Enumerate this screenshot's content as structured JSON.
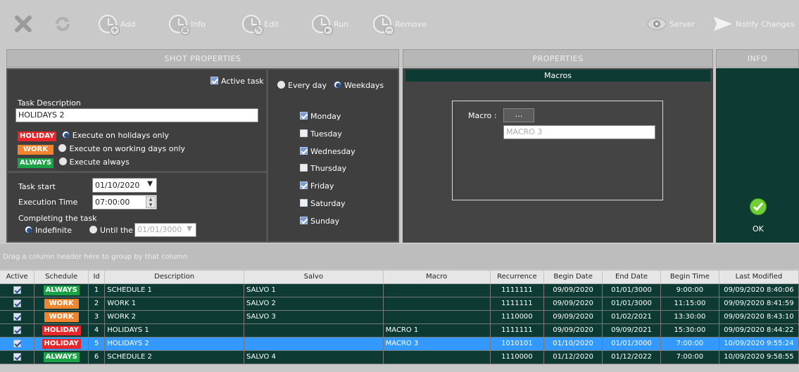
{
  "toolbar": {
    "add": "Add",
    "info": "Info",
    "edit": "Edit",
    "run": "Run",
    "remove": "Remove",
    "server": "Server",
    "notify": "Notify Changes"
  },
  "panels": {
    "shot_properties": "SHOT  PROPERTIES",
    "properties": "PROPERTIES",
    "info": "INFO"
  },
  "shot": {
    "active_task": "Active task",
    "task_description_label": "Task Description",
    "task_description_value": "HOLIDAYS 2",
    "holiday_badge": "HOLIDAY",
    "holiday_text": "Execute on holidays only",
    "work_badge": "WORK",
    "work_text": "Execute on working days only",
    "always_badge": "ALWAYS",
    "always_text": "Execute always",
    "task_start_label": "Task start",
    "task_start_value": "01/10/2020",
    "execution_time_label": "Execution Time",
    "execution_time_value": "07:00:00",
    "completing_label": "Completing the task",
    "indefinite": "Indefinite",
    "until_the": "Until the",
    "until_value": "01/01/3000"
  },
  "days": {
    "every_day": "Every day",
    "weekdays": "Weekdays",
    "items": [
      {
        "label": "Monday",
        "checked": true
      },
      {
        "label": "Tuesday",
        "checked": false
      },
      {
        "label": "Wednesday",
        "checked": true
      },
      {
        "label": "Thursday",
        "checked": false
      },
      {
        "label": "Friday",
        "checked": true
      },
      {
        "label": "Saturday",
        "checked": false
      },
      {
        "label": "Sunday",
        "checked": true
      }
    ]
  },
  "macros": {
    "title": "Macros",
    "macro_label": "Macro :",
    "browse": "...",
    "value": "MACRO 3"
  },
  "info": {
    "ok": "OK"
  },
  "grid": {
    "group_hint": "Drag a column header here to group by that column",
    "columns": [
      "Active",
      "Schedule",
      "Id",
      "Description",
      "Salvo",
      "Macro",
      "Recurrence",
      "Begin Date",
      "End Date",
      "Begin Time",
      "Last Modified"
    ],
    "rows": [
      {
        "schedule": "ALWAYS",
        "id": "1",
        "description": "SCHEDULE 1",
        "salvo": "SALVO 1",
        "macro": "",
        "recurrence": "1111111",
        "begin_date": "09/09/2020",
        "end_date": "01/01/3000",
        "begin_time": "9:00:00",
        "last_modified": "09/09/2020 8:40:06"
      },
      {
        "schedule": "WORK",
        "id": "2",
        "description": "WORK 1",
        "salvo": "SALVO 2",
        "macro": "",
        "recurrence": "1111111",
        "begin_date": "09/09/2020",
        "end_date": "01/01/3000",
        "begin_time": "11:15:00",
        "last_modified": "09/09/2020 8:41:59"
      },
      {
        "schedule": "WORK",
        "id": "3",
        "description": "WORK 2",
        "salvo": "SALVO 3",
        "macro": "",
        "recurrence": "1110000",
        "begin_date": "09/09/2020",
        "end_date": "01/02/2021",
        "begin_time": "13:30:00",
        "last_modified": "09/09/2020 8:43:10"
      },
      {
        "schedule": "HOLIDAY",
        "id": "4",
        "description": "HOLIDAYS 1",
        "salvo": "",
        "macro": "MACRO 1",
        "recurrence": "1111111",
        "begin_date": "09/09/2020",
        "end_date": "09/09/2021",
        "begin_time": "15:30:00",
        "last_modified": "09/09/2020 8:44:22"
      },
      {
        "schedule": "HOLIDAY",
        "id": "5",
        "description": "HOLIDAYS 2",
        "salvo": "",
        "macro": "MACRO 3",
        "recurrence": "1010101",
        "begin_date": "01/10/2020",
        "end_date": "01/01/3000",
        "begin_time": "7:00:00",
        "last_modified": "10/09/2020 9:55:24"
      },
      {
        "schedule": "ALWAYS",
        "id": "6",
        "description": "SCHEDULE 2",
        "salvo": "SALVO 4",
        "macro": "",
        "recurrence": "1110000",
        "begin_date": "01/12/2020",
        "end_date": "01/12/2022",
        "begin_time": "7:00:00",
        "last_modified": "10/09/2020 9:58:55"
      }
    ]
  }
}
